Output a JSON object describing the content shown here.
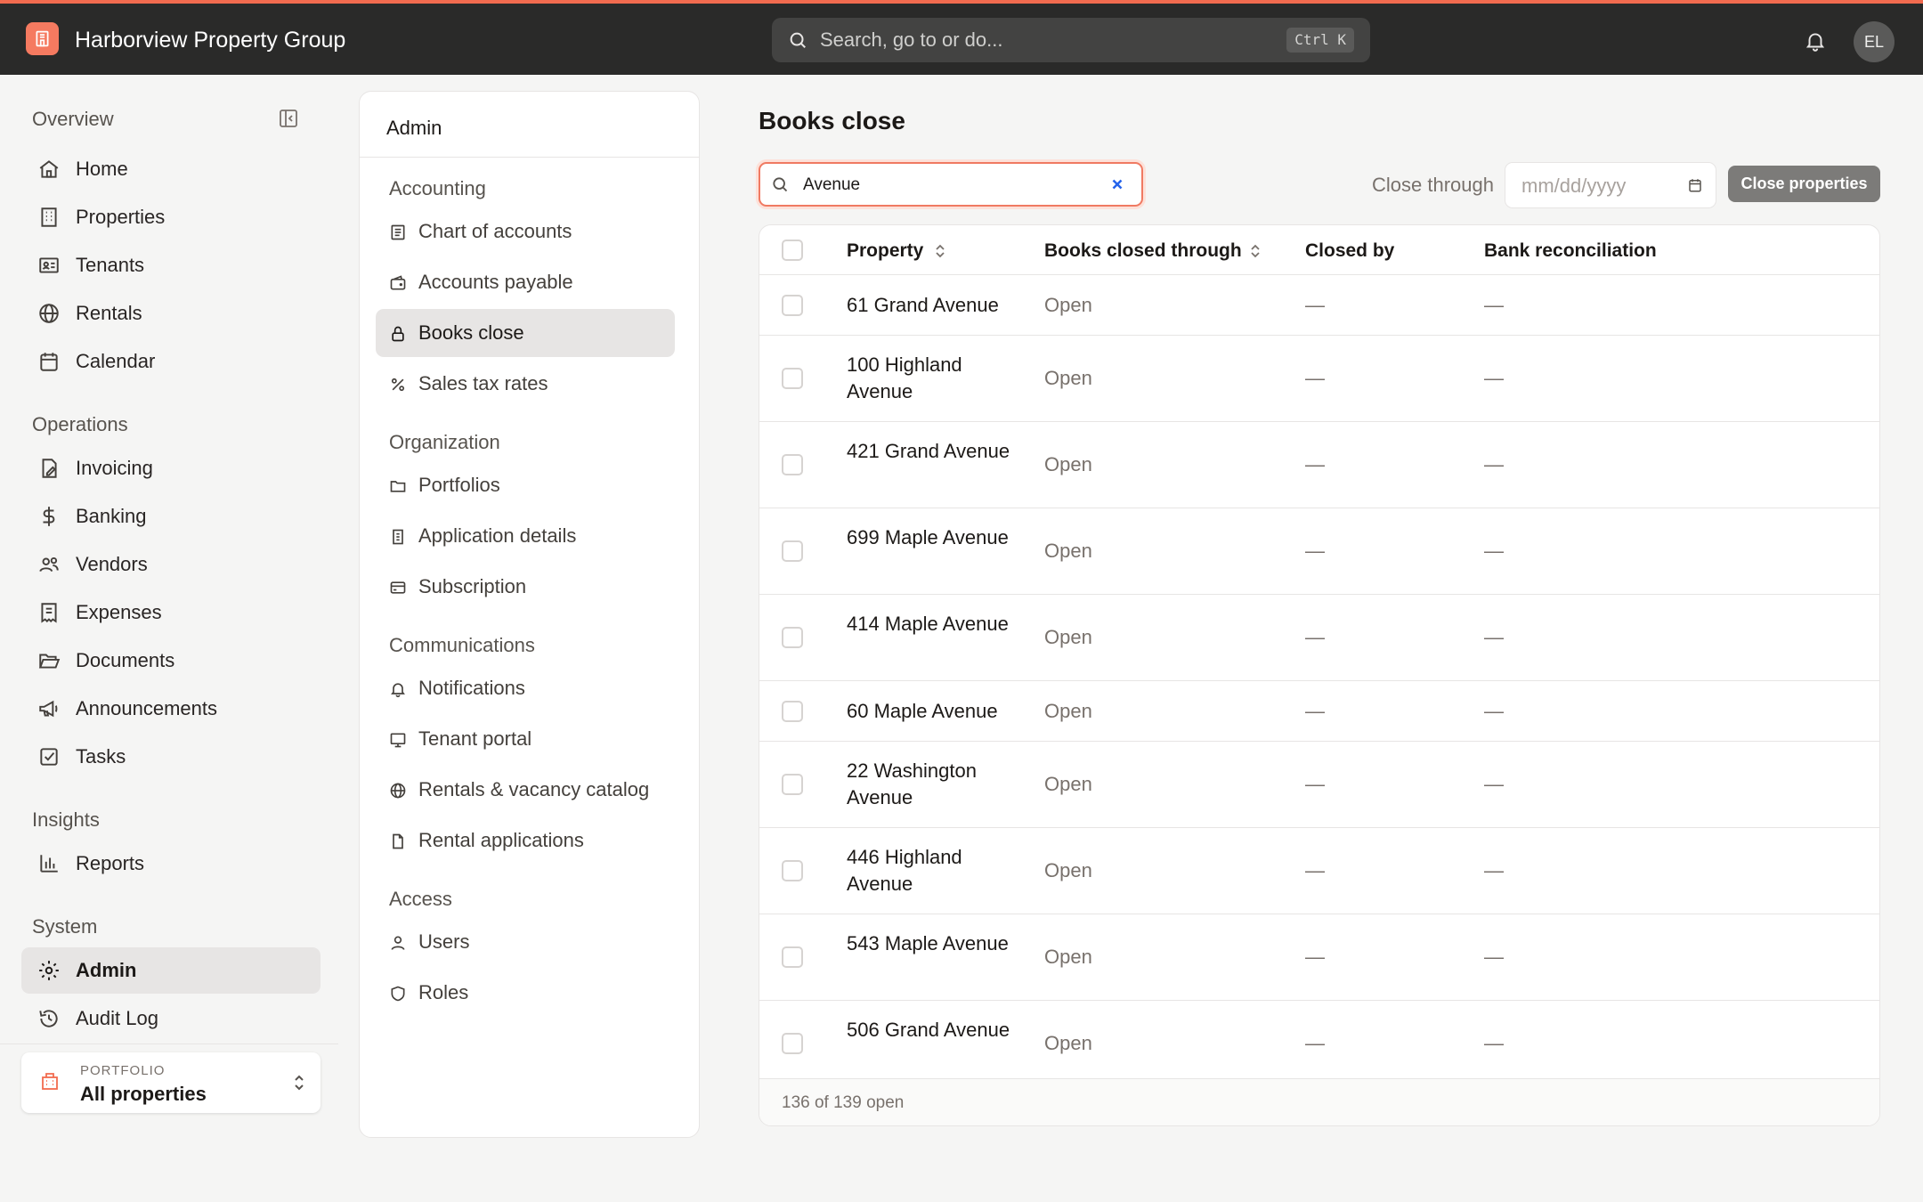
{
  "app": {
    "org_name": "Harborview Property Group",
    "search_placeholder": "Search, go to or do...",
    "search_shortcut": "Ctrl K",
    "user_initials": "EL",
    "accent_color": "#f26b4f"
  },
  "sidebar": {
    "overview_label": "Overview",
    "overview": [
      {
        "label": "Home",
        "icon": "home-icon"
      },
      {
        "label": "Properties",
        "icon": "building-icon"
      },
      {
        "label": "Tenants",
        "icon": "id-card-icon"
      },
      {
        "label": "Rentals",
        "icon": "globe-icon"
      },
      {
        "label": "Calendar",
        "icon": "calendar-icon"
      }
    ],
    "operations_label": "Operations",
    "operations": [
      {
        "label": "Invoicing",
        "icon": "invoice-icon"
      },
      {
        "label": "Banking",
        "icon": "dollar-icon"
      },
      {
        "label": "Vendors",
        "icon": "users-icon"
      },
      {
        "label": "Expenses",
        "icon": "receipt-icon"
      },
      {
        "label": "Documents",
        "icon": "folder-open-icon"
      },
      {
        "label": "Announcements",
        "icon": "megaphone-icon"
      },
      {
        "label": "Tasks",
        "icon": "checkbox-icon"
      }
    ],
    "insights_label": "Insights",
    "insights": [
      {
        "label": "Reports",
        "icon": "bar-chart-icon"
      }
    ],
    "system_label": "System",
    "system": [
      {
        "label": "Admin",
        "icon": "gear-icon",
        "active": true
      },
      {
        "label": "Audit Log",
        "icon": "history-icon"
      }
    ],
    "portfolio_caption": "PORTFOLIO",
    "portfolio_value": "All properties"
  },
  "admin": {
    "title": "Admin",
    "sections": [
      {
        "label": "Accounting",
        "items": [
          "Chart of accounts",
          "Accounts payable",
          "Books close",
          "Sales tax rates"
        ]
      },
      {
        "label": "Organization",
        "items": [
          "Portfolios",
          "Application details",
          "Subscription"
        ]
      },
      {
        "label": "Communications",
        "items": [
          "Notifications",
          "Tenant portal",
          "Rentals & vacancy catalog",
          "Rental applications"
        ]
      },
      {
        "label": "Access",
        "items": [
          "Users",
          "Roles"
        ]
      }
    ],
    "active_item": "Books close"
  },
  "main": {
    "title": "Books close",
    "filter_value": "Avenue",
    "close_through_label": "Close through",
    "date_placeholder": "mm/dd/yyyy",
    "close_button": "Close properties",
    "columns": [
      "Property",
      "Books closed through",
      "Closed by",
      "Bank reconciliation"
    ],
    "rows": [
      {
        "property": "61 Grand Avenue",
        "books_closed_through": "Open",
        "closed_by": "—",
        "bank_reconciliation": "—"
      },
      {
        "property": "100 Highland Avenue",
        "books_closed_through": "Open",
        "closed_by": "—",
        "bank_reconciliation": "—"
      },
      {
        "property": "421 Grand Avenue",
        "books_closed_through": "Open",
        "closed_by": "—",
        "bank_reconciliation": "—"
      },
      {
        "property": "699 Maple Avenue",
        "books_closed_through": "Open",
        "closed_by": "—",
        "bank_reconciliation": "—"
      },
      {
        "property": "414 Maple Avenue",
        "books_closed_through": "Open",
        "closed_by": "—",
        "bank_reconciliation": "—"
      },
      {
        "property": "60 Maple Avenue",
        "books_closed_through": "Open",
        "closed_by": "—",
        "bank_reconciliation": "—"
      },
      {
        "property": "22 Washington Avenue",
        "books_closed_through": "Open",
        "closed_by": "—",
        "bank_reconciliation": "—"
      },
      {
        "property": "446 Highland Avenue",
        "books_closed_through": "Open",
        "closed_by": "—",
        "bank_reconciliation": "—"
      },
      {
        "property": "543 Maple Avenue",
        "books_closed_through": "Open",
        "closed_by": "—",
        "bank_reconciliation": "—"
      },
      {
        "property": "506 Grand Avenue",
        "books_closed_through": "Open",
        "closed_by": "—",
        "bank_reconciliation": "—"
      }
    ],
    "footer": "136 of 139 open"
  }
}
